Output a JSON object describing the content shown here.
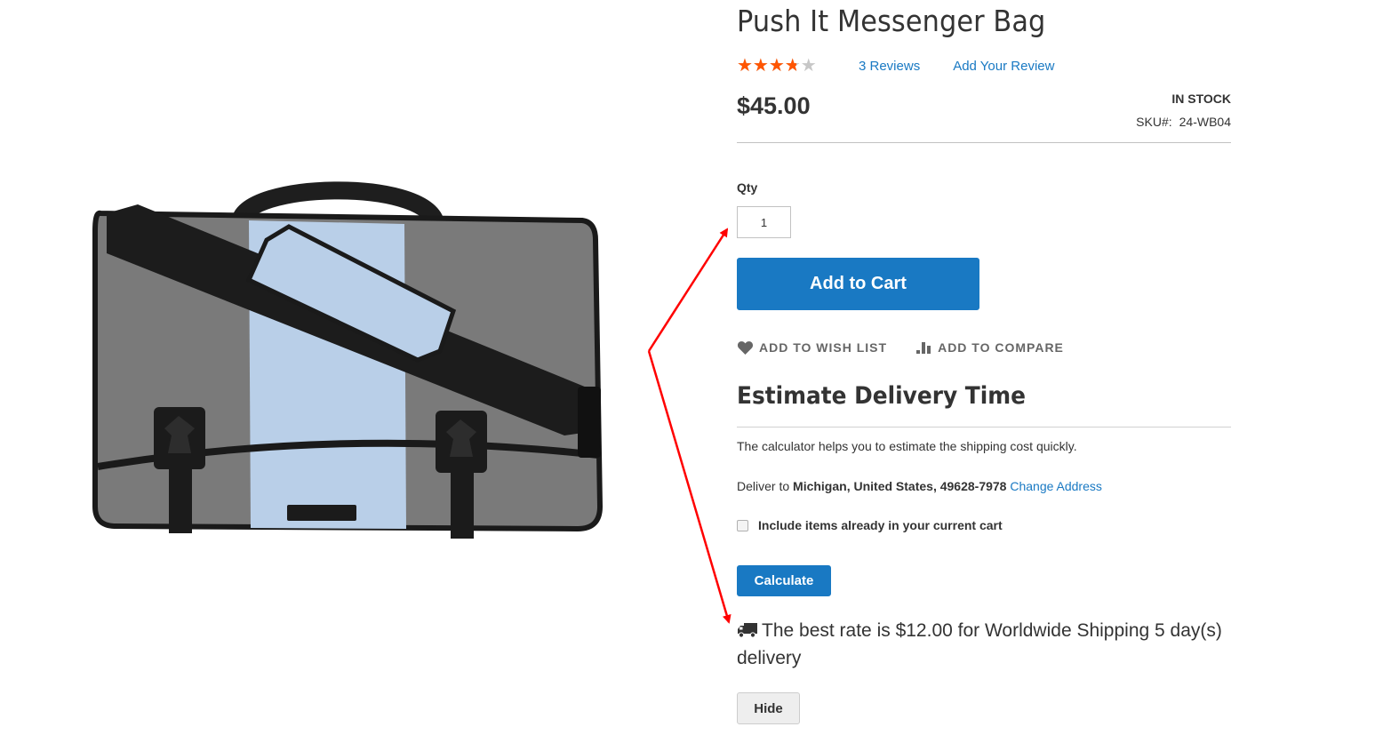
{
  "product": {
    "title": "Push It Messenger Bag",
    "image_alt": "Push It Messenger Bag - gray and light blue messenger bag with black strap",
    "rating": {
      "value": 3.33,
      "max": 5,
      "stars_glyph": "★★★★★",
      "reviews_label": "3  Reviews",
      "add_review_label": "Add Your Review"
    },
    "price": "$45.00",
    "stock_status": "In stock",
    "sku_label": "SKU#:",
    "sku_value": "24-WB04"
  },
  "purchase": {
    "qty_label": "Qty",
    "qty_value": "1",
    "add_to_cart_label": "Add to Cart",
    "wishlist_label": "Add to Wish List",
    "compare_label": "Add to Compare"
  },
  "delivery": {
    "title": "Estimate Delivery Time",
    "description": "The calculator helps you to estimate the shipping cost quickly.",
    "deliver_to_prefix": "Deliver to ",
    "address": "Michigan, United States, 49628-7978",
    "change_address_label": "Change Address",
    "include_cart_label": "Include items already in your current cart",
    "include_cart_checked": false,
    "calculate_label": "Calculate",
    "best_rate_text": "The best rate is $12.00 for Worldwide Shipping 5 day(s) delivery",
    "hide_label": "Hide"
  },
  "colors": {
    "primary": "#1979c3",
    "star_filled": "#ff5501",
    "star_empty": "#c7c7c7",
    "annotation_arrow": "#ff0000"
  }
}
